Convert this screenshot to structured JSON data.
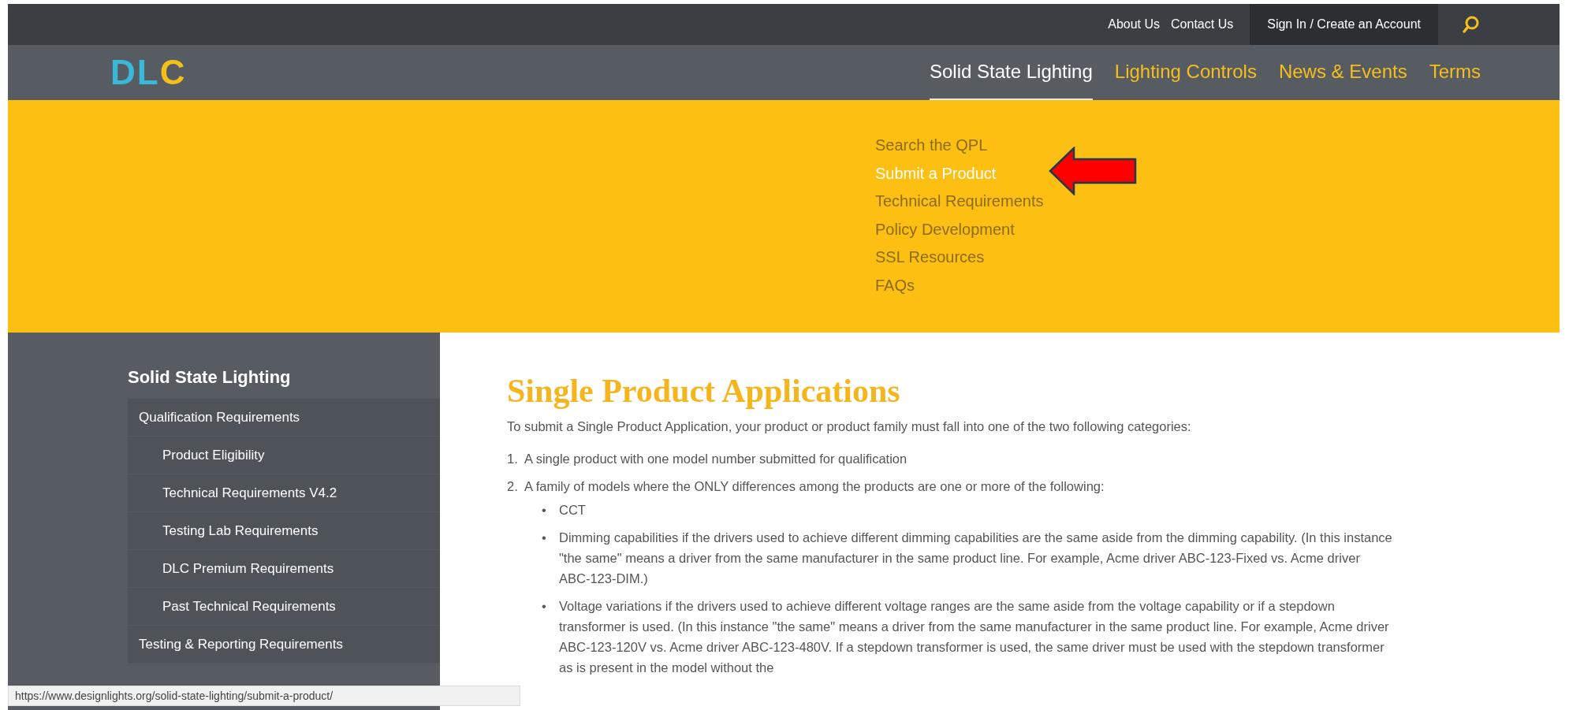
{
  "top_links": [
    "About Us",
    "Contact Us"
  ],
  "account_link": "Sign In / Create an Account",
  "logo": "DLC",
  "nav": [
    {
      "label": "Solid State Lighting",
      "selected": true
    },
    {
      "label": "Lighting Controls",
      "selected": false
    },
    {
      "label": "News & Events",
      "selected": false
    },
    {
      "label": "Terms",
      "selected": false
    }
  ],
  "dropdown": [
    {
      "label": "Search the QPL",
      "selected": false
    },
    {
      "label": "Submit a Product",
      "selected": true
    },
    {
      "label": "Technical Requirements",
      "selected": false
    },
    {
      "label": "Policy Development",
      "selected": false
    },
    {
      "label": "SSL Resources",
      "selected": false
    },
    {
      "label": "FAQs",
      "selected": false
    }
  ],
  "sidebar": {
    "title": "Solid State Lighting",
    "items": [
      {
        "label": "Qualification Requirements",
        "children": [
          {
            "label": "Product Eligibility"
          },
          {
            "label": "Technical Requirements V4.2"
          },
          {
            "label": "Testing Lab Requirements"
          },
          {
            "label": "DLC Premium Requirements"
          },
          {
            "label": "Past Technical Requirements"
          }
        ]
      },
      {
        "label": "Testing & Reporting Requirements"
      }
    ]
  },
  "content": {
    "heading": "Single Product Applications",
    "intro": "To submit a Single Product Application, your product or product family must fall into one of the two following categories:",
    "steps": [
      {
        "marker": "1.",
        "text": "A single product with one model number submitted for qualification"
      },
      {
        "marker": "2.",
        "text": "A family of models where the ONLY differences among the products are one or more of the following:",
        "children": [
          {
            "marker": "•",
            "text": "CCT"
          },
          {
            "marker": "•",
            "text": "Dimming capabilities if the drivers used to achieve different dimming capabilities are the same aside from the dimming capability. (In this instance \"the same\" means a driver from the same manufacturer in the same product line. For example, Acme driver ABC-123-Fixed vs. Acme driver ABC-123-DIM.)"
          },
          {
            "marker": "•",
            "text": "Voltage variations if the drivers used to achieve different voltage ranges are the same aside from the voltage capability or if a stepdown transformer is used. (In this instance \"the same\" means a driver from the same manufacturer in the same product line. For example, Acme driver ABC-123-120V vs. Acme driver ABC-123-480V. If a stepdown transformer is used, the same driver must be used with the stepdown transformer as is present in the model without the"
          }
        ]
      }
    ]
  },
  "status_bar": "https://www.designlights.org/solid-state-lighting/submit-a-product/"
}
